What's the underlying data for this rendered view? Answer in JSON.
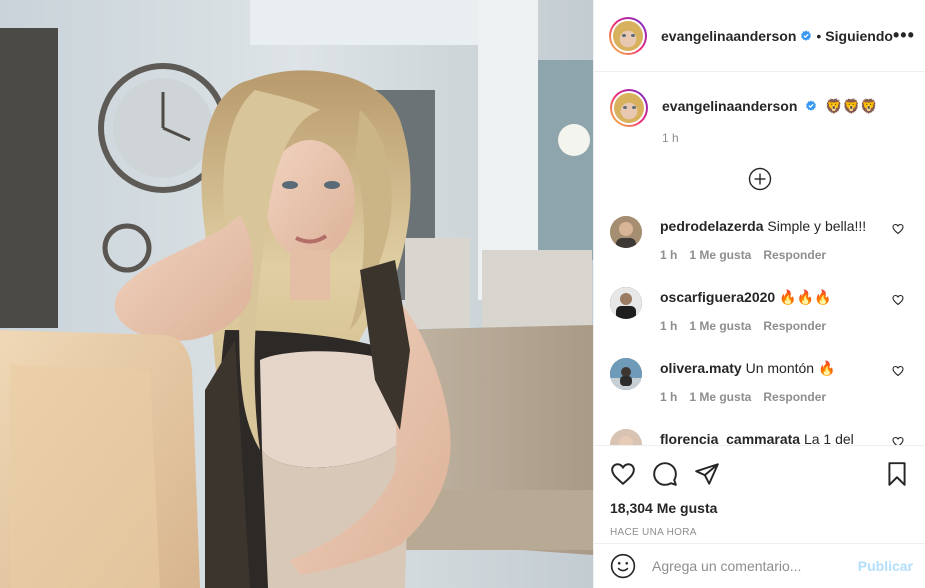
{
  "post": {
    "author": "evangelinaanderson",
    "follow_separator": "•",
    "follow_status": "Siguiendo",
    "more_label": "•••",
    "caption_emojis": "🦁🦁🦁",
    "caption_time": "1 h",
    "likes_text": "18,304 Me gusta",
    "time_ago": "Hace una hora"
  },
  "comments": [
    {
      "user": "pedrodelazerda",
      "text": "Simple y bella!!!",
      "time": "1 h",
      "likes": "1 Me gusta",
      "reply": "Responder",
      "avatar_color": "#b8a48c"
    },
    {
      "user": "oscarfiguera2020",
      "text": "🔥🔥🔥",
      "time": "1 h",
      "likes": "1 Me gusta",
      "reply": "Responder",
      "avatar_color": "#2b2b2b"
    },
    {
      "user": "olivera.maty",
      "text": "Un montón 🔥",
      "time": "1 h",
      "likes": "1 Me gusta",
      "reply": "Responder",
      "avatar_color": "#4a6e8a"
    },
    {
      "user": "florencia_cammarata",
      "text": "La 1 del",
      "time": "",
      "likes": "",
      "reply": "",
      "avatar_color": "#c9b3a4"
    }
  ],
  "add_comment": {
    "placeholder": "Agrega un comentario...",
    "publish": "Publicar"
  },
  "icons": [
    "heart-icon",
    "comment-icon",
    "share-icon",
    "bookmark-icon",
    "emoji-icon",
    "add-circle-icon",
    "verified-badge-icon",
    "more-icon"
  ],
  "colors": {
    "border": "#efefef",
    "muted": "#8e8e8e",
    "text": "#262626",
    "verified": "#3897f0",
    "publish_disabled": "#b2dffc"
  }
}
